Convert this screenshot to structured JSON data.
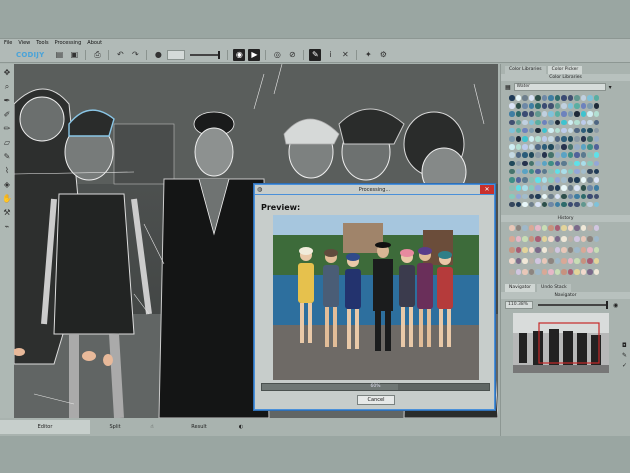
{
  "menu": [
    "File",
    "View",
    "Tools",
    "Processing",
    "About"
  ],
  "app_logo": "CODIJY",
  "toolbar": {
    "icons": [
      "open-icon",
      "save-icon",
      "print-icon",
      "undo-icon",
      "redo-icon",
      "brush-icon",
      "play-icon",
      "eye-icon",
      "compare-icon",
      "pin-icon",
      "info-icon",
      "wand-icon",
      "gear-icon"
    ]
  },
  "left_tools": [
    "move-icon",
    "zoom-icon",
    "pen-icon",
    "picker-icon",
    "brush-icon",
    "eraser-icon",
    "pencil-icon",
    "dropper-icon",
    "fill-icon",
    "hand-icon",
    "wand-icon",
    "sample-icon"
  ],
  "bottom_tabs": {
    "editor": "Editor",
    "split": "Split",
    "result": "Result"
  },
  "right_panel": {
    "top_tabs": [
      "Color Libraries",
      "Color Picker"
    ],
    "color_libraries_title": "Color Libraries",
    "library_dropdown": "Water",
    "history_title": "History",
    "bottom_tabs": [
      "Navigator",
      "Undo Stack"
    ],
    "navigator_title": "Navigator",
    "zoom_level": "110.38%"
  },
  "dialog": {
    "title": "Processing...",
    "preview_label": "Preview:",
    "progress_percent": 60,
    "progress_text": "60%",
    "cancel_label": "Cancel"
  },
  "colors": {
    "accent": "#4a90d9",
    "close": "#c9302c",
    "logo": "#4aa3d8"
  }
}
